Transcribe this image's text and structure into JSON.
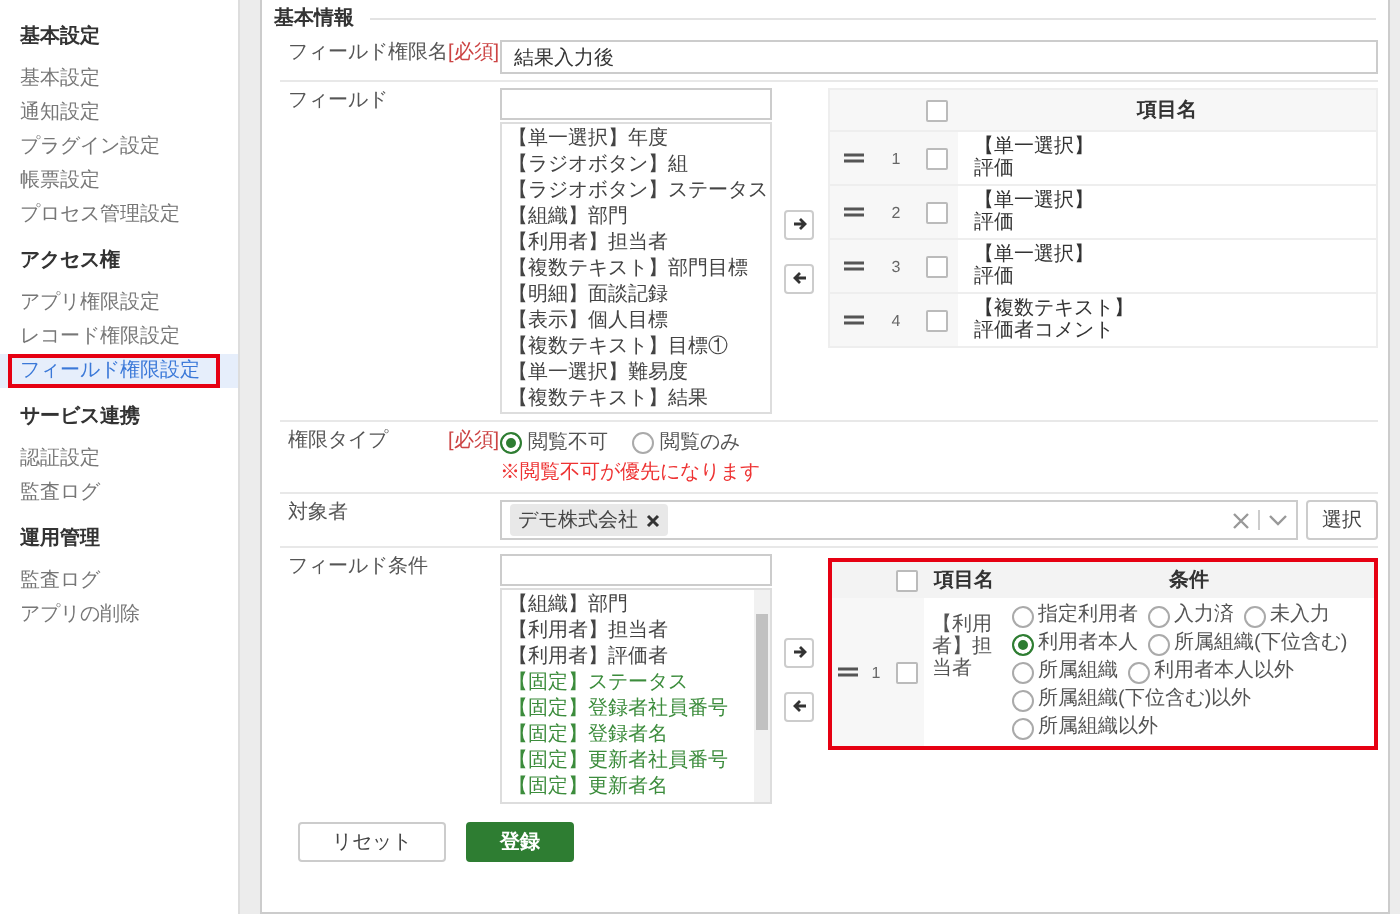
{
  "sidebar": {
    "sections": [
      {
        "heading": "基本設定",
        "items": [
          {
            "label": "基本設定",
            "selected": false,
            "highlighted": false
          },
          {
            "label": "通知設定",
            "selected": false,
            "highlighted": false
          },
          {
            "label": "プラグイン設定",
            "selected": false,
            "highlighted": false
          },
          {
            "label": "帳票設定",
            "selected": false,
            "highlighted": false
          },
          {
            "label": "プロセス管理設定",
            "selected": false,
            "highlighted": false
          }
        ]
      },
      {
        "heading": "アクセス権",
        "items": [
          {
            "label": "アプリ権限設定",
            "selected": false,
            "highlighted": false
          },
          {
            "label": "レコード権限設定",
            "selected": false,
            "highlighted": false
          },
          {
            "label": "フィールド権限設定",
            "selected": true,
            "highlighted": true
          }
        ]
      },
      {
        "heading": "サービス連携",
        "items": [
          {
            "label": "認証設定",
            "selected": false,
            "highlighted": false
          },
          {
            "label": "監査ログ",
            "selected": false,
            "highlighted": false
          }
        ]
      },
      {
        "heading": "運用管理",
        "items": [
          {
            "label": "監査ログ",
            "selected": false,
            "highlighted": false
          },
          {
            "label": "アプリの削除",
            "selected": false,
            "highlighted": false
          }
        ]
      }
    ]
  },
  "main": {
    "section_title": "基本情報",
    "name_field": {
      "label": "フィールド権限名",
      "required": "[必須]",
      "value": "結果入力後"
    },
    "fields": {
      "label": "フィールド",
      "options": [
        {
          "text": "【単一選択】年度",
          "kind": "field"
        },
        {
          "text": "【ラジオボタン】組",
          "kind": "field"
        },
        {
          "text": "【ラジオボタン】ステータス",
          "kind": "field"
        },
        {
          "text": "【組織】部門",
          "kind": "field"
        },
        {
          "text": "【利用者】担当者",
          "kind": "field"
        },
        {
          "text": "【複数テキスト】部門目標",
          "kind": "field"
        },
        {
          "text": "【明細】面談記録",
          "kind": "field"
        },
        {
          "text": "【表示】個人目標",
          "kind": "field"
        },
        {
          "text": "【複数テキスト】目標①",
          "kind": "field"
        },
        {
          "text": "【単一選択】難易度",
          "kind": "field"
        },
        {
          "text": "【複数テキスト】結果",
          "kind": "field"
        }
      ],
      "table": {
        "header_checked": false,
        "column": "項目名",
        "rows": [
          {
            "number": "1",
            "checked": false,
            "type": "【単一選択】",
            "name": "評価"
          },
          {
            "number": "2",
            "checked": false,
            "type": "【単一選択】",
            "name": "評価"
          },
          {
            "number": "3",
            "checked": false,
            "type": "【単一選択】",
            "name": "評価"
          },
          {
            "number": "4",
            "checked": false,
            "type": "【複数テキスト】",
            "name": "評価者コメント"
          }
        ]
      }
    },
    "permission": {
      "label": "権限タイプ",
      "required": "[必須]",
      "options": [
        {
          "label": "閲覧不可",
          "selected": true
        },
        {
          "label": "閲覧のみ",
          "selected": false
        }
      ],
      "note": "※閲覧不可が優先になります"
    },
    "target": {
      "label": "対象者",
      "chips": [
        "デモ株式会社"
      ],
      "button": "選択"
    },
    "conditions": {
      "label": "フィールド条件",
      "options": [
        {
          "text": "【組織】部門",
          "kind": "field"
        },
        {
          "text": "【利用者】担当者",
          "kind": "field"
        },
        {
          "text": "【利用者】評価者",
          "kind": "field"
        },
        {
          "text": "【固定】ステータス",
          "kind": "fixed"
        },
        {
          "text": "【固定】登録者社員番号",
          "kind": "fixed"
        },
        {
          "text": "【固定】登録者名",
          "kind": "fixed"
        },
        {
          "text": "【固定】更新者社員番号",
          "kind": "fixed"
        },
        {
          "text": "【固定】更新者名",
          "kind": "fixed"
        }
      ],
      "table": {
        "highlighted": true,
        "header_checked": false,
        "columns": [
          "項目名",
          "条件"
        ],
        "rows": [
          {
            "number": "1",
            "checked": false,
            "item": "【利用者】担当者",
            "choices": [
              {
                "label": "指定利用者",
                "selected": false
              },
              {
                "label": "入力済",
                "selected": false
              },
              {
                "label": "未入力",
                "selected": false
              },
              {
                "label": "利用者本人",
                "selected": true
              },
              {
                "label": "所属組織(下位含む)",
                "selected": false
              },
              {
                "label": "所属組織",
                "selected": false
              },
              {
                "label": "利用者本人以外",
                "selected": false
              },
              {
                "label": "所属組織(下位含む)以外",
                "selected": false
              },
              {
                "label": "所属組織以外",
                "selected": false
              }
            ]
          }
        ]
      }
    },
    "buttons": [
      {
        "label": "リセット",
        "kind": "secondary"
      },
      {
        "label": "登録",
        "kind": "primary"
      }
    ]
  }
}
